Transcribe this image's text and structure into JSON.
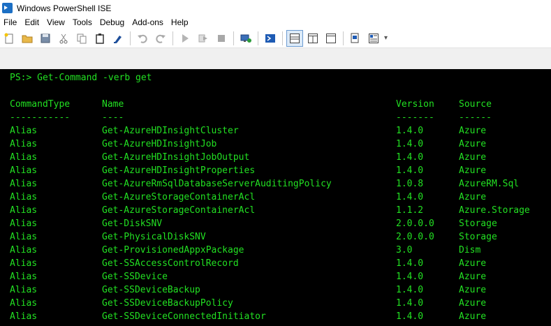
{
  "window": {
    "title": "Windows PowerShell ISE"
  },
  "menu": [
    "File",
    "Edit",
    "View",
    "Tools",
    "Debug",
    "Add-ons",
    "Help"
  ],
  "toolbar": {
    "icons": [
      "new-file-icon",
      "open-folder-icon",
      "save-icon",
      "cut-icon",
      "copy-icon",
      "paste-icon",
      "clear-console-icon",
      "undo-icon",
      "redo-icon",
      "run-script-icon",
      "run-selection-icon",
      "stop-icon",
      "new-remote-tab-icon",
      "start-powershell-icon",
      "show-script-top-icon",
      "show-script-right-icon",
      "show-script-maximized-icon",
      "show-command-window-icon",
      "show-command-addon-icon"
    ]
  },
  "console": {
    "prompt": "PS:> Get-Command -verb get",
    "headers": [
      "CommandType",
      "Name",
      "Version",
      "Source"
    ],
    "separators": [
      "-----------",
      "----",
      "-------",
      "------"
    ],
    "rows": [
      [
        "Alias",
        "Get-AzureHDInsightCluster",
        "1.4.0",
        "Azure"
      ],
      [
        "Alias",
        "Get-AzureHDInsightJob",
        "1.4.0",
        "Azure"
      ],
      [
        "Alias",
        "Get-AzureHDInsightJobOutput",
        "1.4.0",
        "Azure"
      ],
      [
        "Alias",
        "Get-AzureHDInsightProperties",
        "1.4.0",
        "Azure"
      ],
      [
        "Alias",
        "Get-AzureRmSqlDatabaseServerAuditingPolicy",
        "1.0.8",
        "AzureRM.Sql"
      ],
      [
        "Alias",
        "Get-AzureStorageContainerAcl",
        "1.4.0",
        "Azure"
      ],
      [
        "Alias",
        "Get-AzureStorageContainerAcl",
        "1.1.2",
        "Azure.Storage"
      ],
      [
        "Alias",
        "Get-DiskSNV",
        "2.0.0.0",
        "Storage"
      ],
      [
        "Alias",
        "Get-PhysicalDiskSNV",
        "2.0.0.0",
        "Storage"
      ],
      [
        "Alias",
        "Get-ProvisionedAppxPackage",
        "3.0",
        "Dism"
      ],
      [
        "Alias",
        "Get-SSAccessControlRecord",
        "1.4.0",
        "Azure"
      ],
      [
        "Alias",
        "Get-SSDevice",
        "1.4.0",
        "Azure"
      ],
      [
        "Alias",
        "Get-SSDeviceBackup",
        "1.4.0",
        "Azure"
      ],
      [
        "Alias",
        "Get-SSDeviceBackupPolicy",
        "1.4.0",
        "Azure"
      ],
      [
        "Alias",
        "Get-SSDeviceConnectedInitiator",
        "1.4.0",
        "Azure"
      ]
    ]
  }
}
